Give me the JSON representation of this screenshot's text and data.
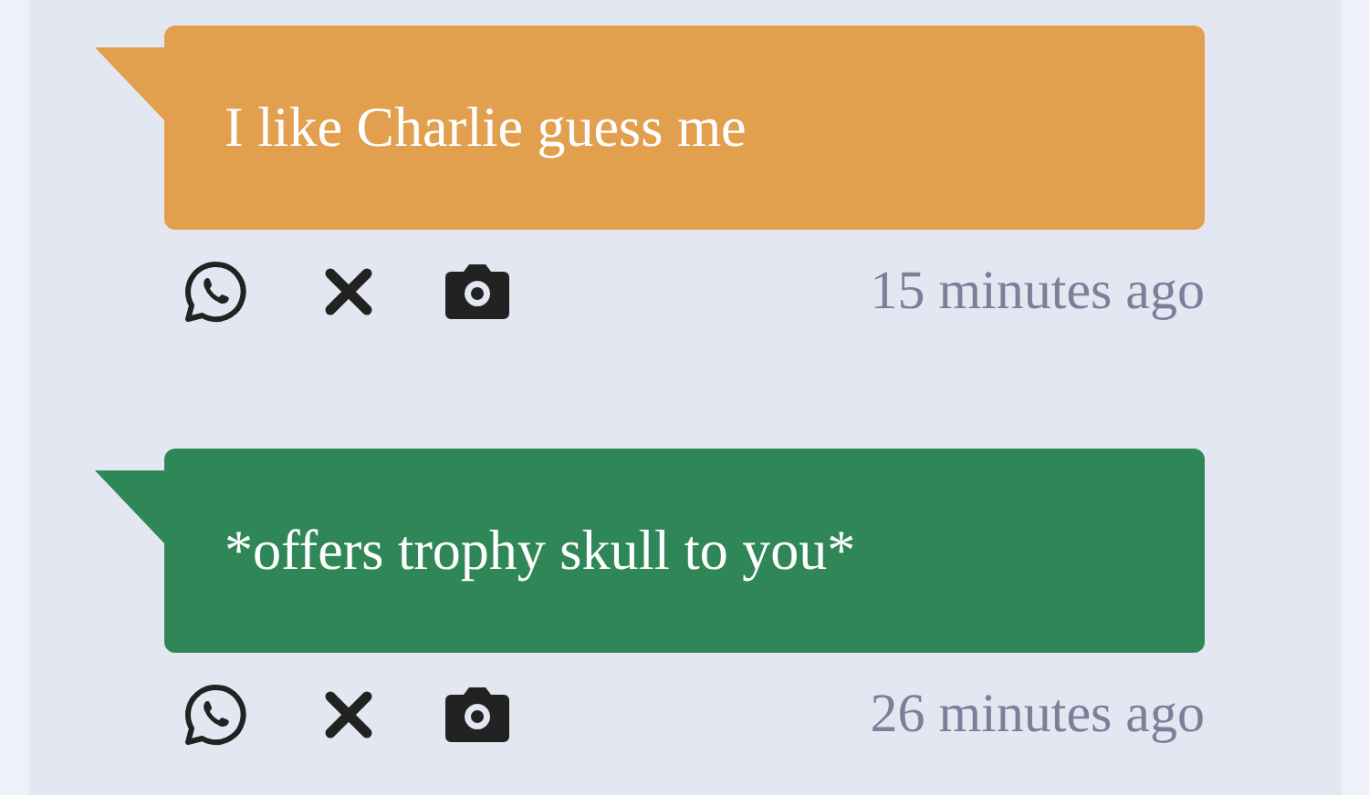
{
  "messages": [
    {
      "text": "I like Charlie guess me",
      "color": "#e2a04e",
      "time": "15 minutes ago"
    },
    {
      "text": "*offers trophy skull to you*",
      "color": "#2f8757",
      "time": "26 minutes ago"
    }
  ]
}
